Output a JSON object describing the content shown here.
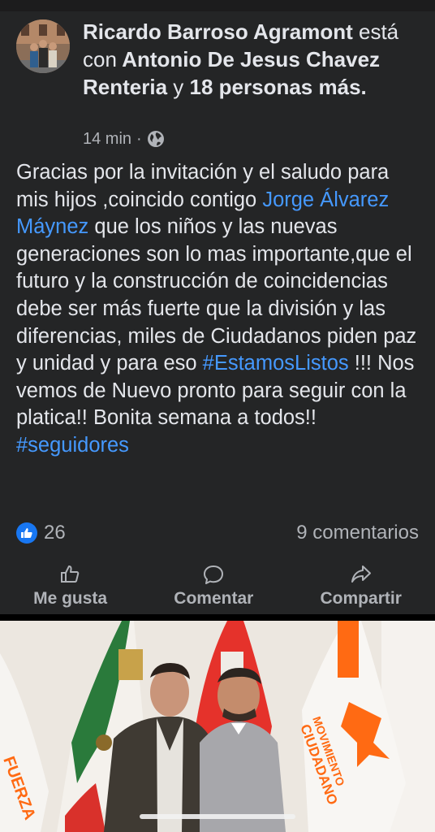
{
  "post": {
    "author": "Ricardo Barroso Agramont",
    "with_word": "está con",
    "tagged": "Antonio De Jesus Chavez Renteria",
    "and_word": "y",
    "others": "18 personas más.",
    "time": "14 min",
    "separator": "·",
    "privacy_icon": "globe-icon",
    "body": {
      "p1": "Gracias por la invitación  y el saludo para mis hijos ,coincido contigo ",
      "mention": "Jorge Álvarez Máynez",
      "p2": "  que los niños y las nuevas generaciones son lo mas importante,que el futuro y la construcción de coincidencias debe ser más fuerte que la división y las diferencias, miles de Ciudadanos piden paz y unidad y para eso ",
      "hashtag1": "#EstamosListos",
      "p3": " !!! Nos vemos de Nuevo pronto para seguir con la platica!! Bonita semana a todos!! ",
      "hashtag2": "#seguidores"
    },
    "reactions": {
      "likes": "26",
      "comments": "9 comentarios"
    },
    "actions": {
      "like": "Me gusta",
      "comment": "Comentar",
      "share": "Compartir"
    }
  },
  "photo": {
    "flag_labels": {
      "left": "FUERZA",
      "right_line1": "MOVIMIENTO",
      "right_line2": "CIUDADANO"
    }
  },
  "colors": {
    "background": "#242526",
    "text": "#e4e6eb",
    "secondary": "#b0b3b8",
    "link": "#4599ff",
    "like_blue": "#1877f2",
    "mc_orange": "#ff6a13"
  }
}
